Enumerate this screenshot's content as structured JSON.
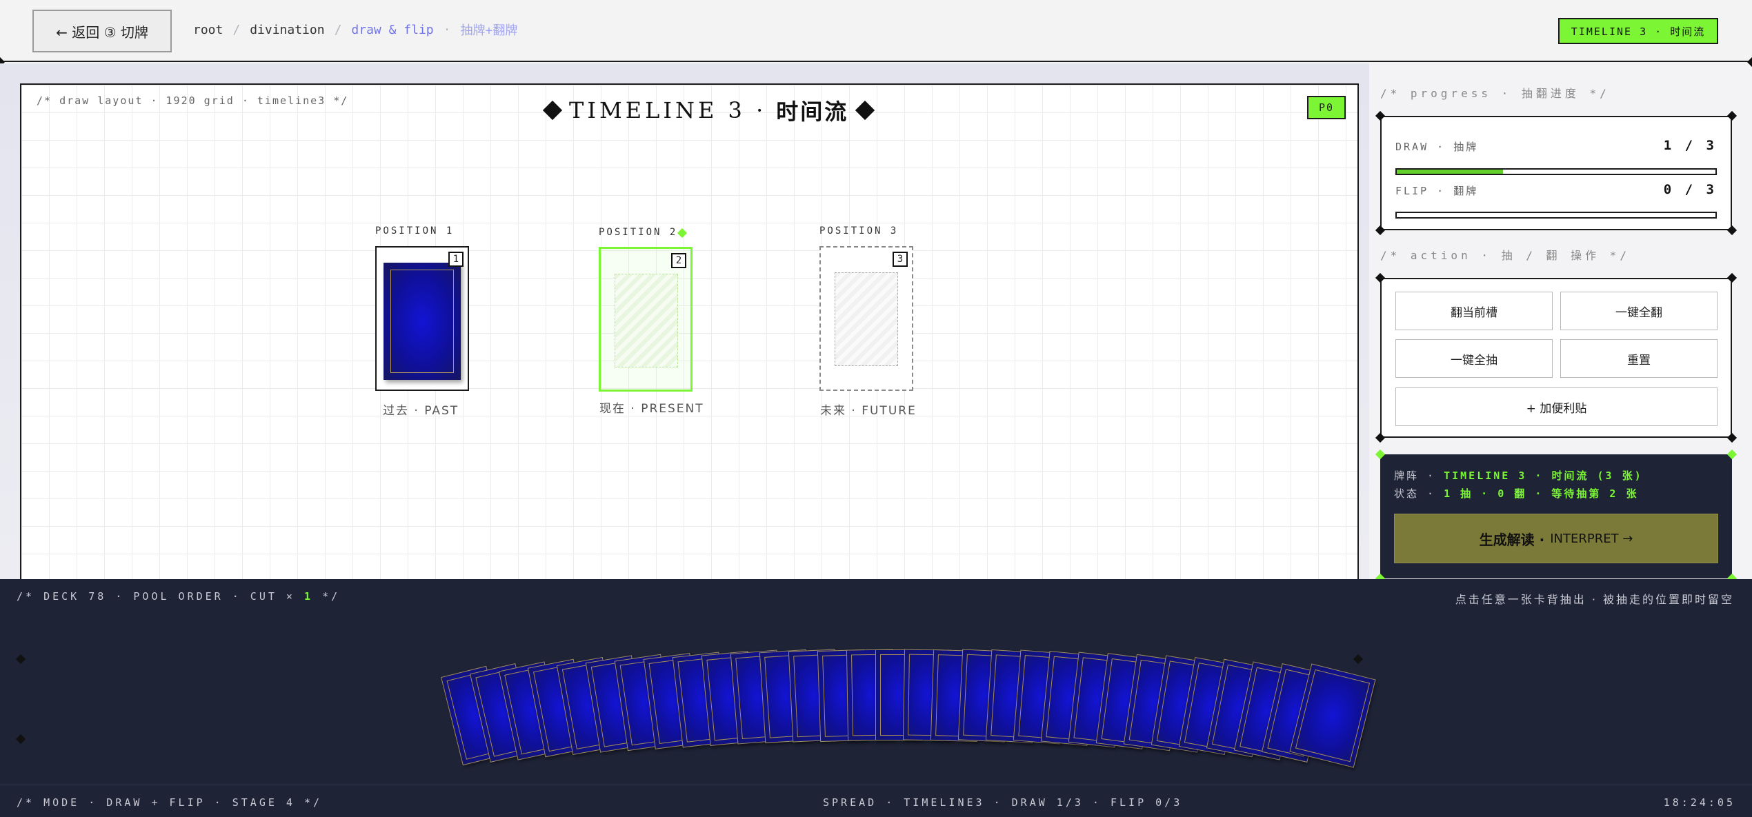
{
  "topbar": {
    "back_label": "← 返回 ③ 切牌",
    "crumbs": [
      "root",
      "divination",
      "draw & flip",
      "抽牌+翻牌"
    ],
    "separators": [
      "/",
      "/",
      "·"
    ],
    "badge": "TIMELINE 3 · 时间流"
  },
  "board": {
    "comment": "/* draw layout · 1920 grid · timeline3 */",
    "title_en": "TIMELINE 3 ·",
    "title_cn": "时间流",
    "p_badge": "P0",
    "slots": [
      {
        "label": "POSITION 1",
        "num": "1",
        "caption": "过去 · PAST",
        "state": "drawn"
      },
      {
        "label": "POSITION 2",
        "num": "2",
        "caption": "现在 · PRESENT",
        "state": "active"
      },
      {
        "label": "POSITION 3",
        "num": "3",
        "caption": "未来 · FUTURE",
        "state": "empty"
      }
    ]
  },
  "sidebar": {
    "progress_comment": "/* progress · 抽翻进度 */",
    "draw_label": "DRAW · 抽牌",
    "draw_value": "1 / 3",
    "draw_fraction": 0.333,
    "flip_label": "FLIP · 翻牌",
    "flip_value": "0 / 3",
    "flip_fraction": 0,
    "action_comment": "/* action · 抽 / 翻 操作 */",
    "actions": {
      "flip_current": "翻当前槽",
      "flip_all": "一键全翻",
      "draw_all": "一键全抽",
      "reset": "重置",
      "add_note": "+ 加便利贴"
    },
    "status": {
      "spread_key": "牌阵 ·",
      "spread_val": "TIMELINE 3 · 时间流 (3 张)",
      "state_key": "状态 ·",
      "state_val": "1 抽 · 0 翻 · 等待抽第 2 张"
    },
    "interpret_cn": "生成解读 ·",
    "interpret_en": "INTERPRET →"
  },
  "deck": {
    "comment_prefix": "/* DECK 78 · POOL ORDER · CUT ×",
    "cut_value": "1",
    "comment_suffix": "*/",
    "hint": "点击任意一张卡背抽出 · 被抽走的位置即时留空",
    "visible_cards": 31
  },
  "footer": {
    "mode": "/* MODE · DRAW + FLIP · STAGE 4 */",
    "spread": "SPREAD · TIMELINE3 · DRAW 1/3 · FLIP 0/3",
    "time": "18:24:05"
  },
  "colors": {
    "accent": "#7cf535",
    "dark_panel": "#1e2336",
    "card_blue": "#1314d4",
    "link": "#6f73e6"
  }
}
